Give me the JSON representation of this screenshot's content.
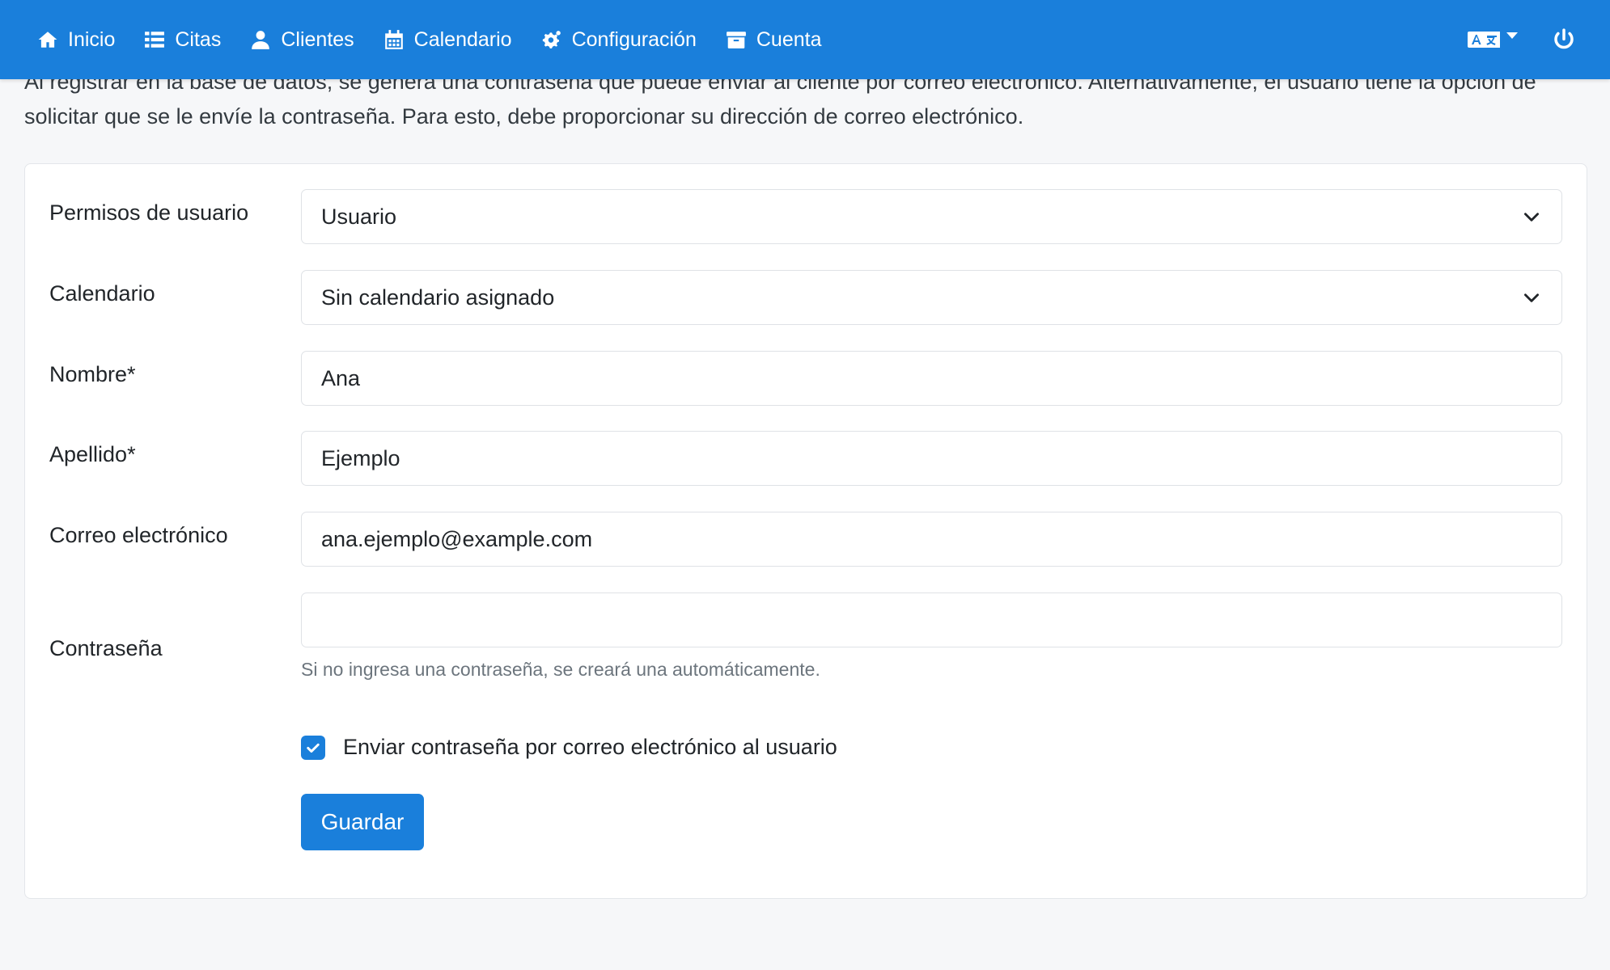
{
  "nav": {
    "items": [
      {
        "label": "Inicio",
        "icon": "home-icon"
      },
      {
        "label": "Citas",
        "icon": "list-icon"
      },
      {
        "label": "Clientes",
        "icon": "user-icon"
      },
      {
        "label": "Calendario",
        "icon": "calendar-icon"
      },
      {
        "label": "Configuración",
        "icon": "cogs-icon"
      },
      {
        "label": "Cuenta",
        "icon": "archive-icon"
      }
    ],
    "language_icon": "language-icon",
    "power_icon": "power-icon"
  },
  "intro_text": "Al registrar en la base de datos, se genera una contraseña que puede enviar al cliente por correo electrónico. Alternativamente, el usuario tiene la opción de solicitar que se le envíe la contraseña. Para esto, debe proporcionar su dirección de correo electrónico.",
  "form": {
    "permissions": {
      "label": "Permisos de usuario",
      "value": "Usuario"
    },
    "calendar": {
      "label": "Calendario",
      "value": "Sin calendario asignado"
    },
    "first_name": {
      "label": "Nombre*",
      "value": "Ana"
    },
    "last_name": {
      "label": "Apellido*",
      "value": "Ejemplo"
    },
    "email": {
      "label": "Correo electrónico",
      "value": "ana.ejemplo@example.com"
    },
    "password": {
      "label": "Contraseña",
      "value": "",
      "help": "Si no ingresa una contraseña, se creará una automáticamente."
    },
    "send_password": {
      "label": "Enviar contraseña por correo electrónico al usuario",
      "checked": true
    },
    "save_label": "Guardar"
  },
  "colors": {
    "primary": "#1a7fdb",
    "background": "#f6f7f9",
    "muted_text": "#6c757d"
  }
}
